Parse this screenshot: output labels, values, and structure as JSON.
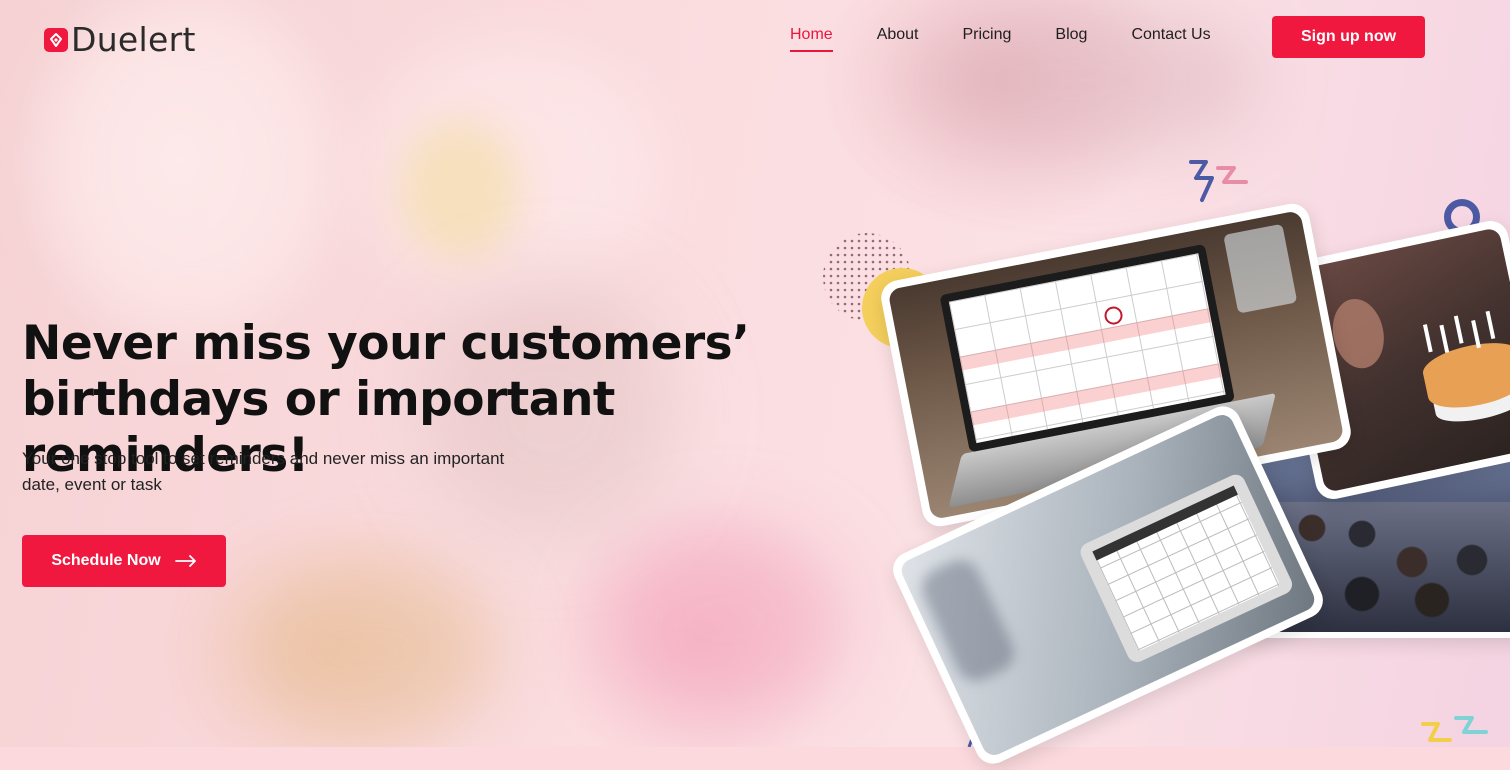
{
  "brand": {
    "name": "Duelert"
  },
  "nav": {
    "items": [
      {
        "label": "Home",
        "active": true
      },
      {
        "label": "About",
        "active": false
      },
      {
        "label": "Pricing",
        "active": false
      },
      {
        "label": "Blog",
        "active": false
      },
      {
        "label": "Contact Us",
        "active": false
      }
    ],
    "signup_label": "Sign up now"
  },
  "hero": {
    "title_line1": "Never miss your customers’",
    "title_line2": "birthdays or important reminders!",
    "subtitle": "Your one stop tool to set reminders and never miss an important date, event or task",
    "cta_label": "Schedule Now"
  },
  "colors": {
    "accent": "#f0183f",
    "text": "#111111",
    "nav_text": "#1f1f1f"
  },
  "icons": {
    "cta": "arrow-right-icon",
    "logo": "bell-logo-icon"
  }
}
